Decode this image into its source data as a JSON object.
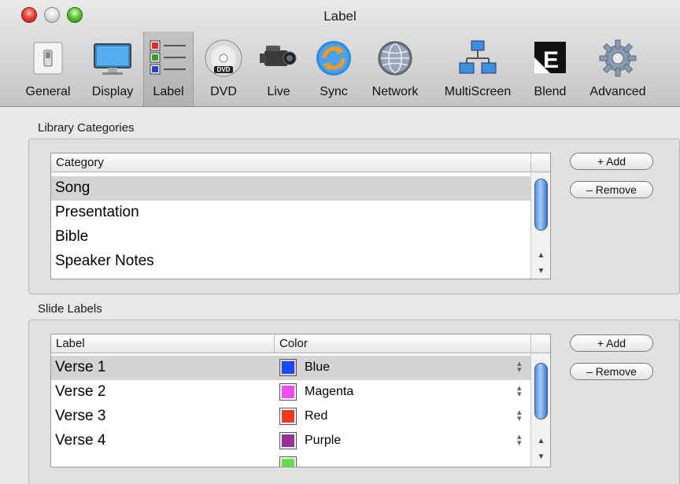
{
  "window": {
    "title": "Label"
  },
  "toolbar": {
    "items": [
      {
        "label": "General",
        "icon": "switch-icon"
      },
      {
        "label": "Display",
        "icon": "monitor-icon"
      },
      {
        "label": "Label",
        "icon": "label-list-icon",
        "selected": true
      },
      {
        "label": "DVD",
        "icon": "dvd-icon"
      },
      {
        "label": "Live",
        "icon": "camcorder-icon"
      },
      {
        "label": "Sync",
        "icon": "sync-icon"
      },
      {
        "label": "Network",
        "icon": "globe-icon"
      },
      {
        "label": "MultiScreen",
        "icon": "multiscreen-icon"
      },
      {
        "label": "Blend",
        "icon": "blend-icon"
      },
      {
        "label": "Advanced",
        "icon": "gear-icon"
      }
    ]
  },
  "library": {
    "title": "Library Categories",
    "column_header": "Category",
    "rows": [
      "Song",
      "Presentation",
      "Bible",
      "Speaker Notes"
    ],
    "selected_index": 0,
    "add_label": "+ Add",
    "remove_label": "– Remove"
  },
  "slide_labels": {
    "title": "Slide Labels",
    "columns": [
      "Label",
      "Color"
    ],
    "rows": [
      {
        "label": "Verse 1",
        "color_name": "Blue",
        "color": "#1f48f5"
      },
      {
        "label": "Verse 2",
        "color_name": "Magenta",
        "color": "#f04cf0"
      },
      {
        "label": "Verse 3",
        "color_name": "Red",
        "color": "#f03a22"
      },
      {
        "label": "Verse 4",
        "color_name": "Purple",
        "color": "#9a2f9a"
      }
    ],
    "selected_index": 0,
    "add_label": "+ Add",
    "remove_label": "– Remove"
  }
}
